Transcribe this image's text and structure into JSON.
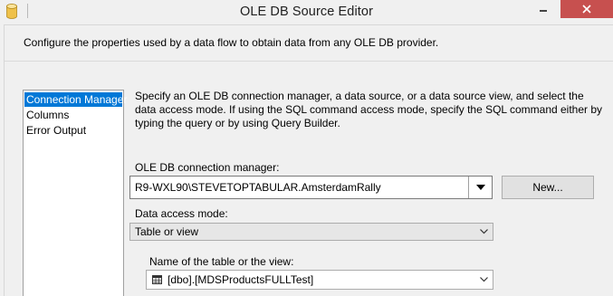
{
  "window": {
    "title": "OLE DB Source Editor",
    "icon": "database-icon",
    "close_color": "#c7504f"
  },
  "header": {
    "intro": "Configure the properties used by a data flow to obtain data from any OLE DB provider."
  },
  "nav": {
    "items": [
      {
        "label": "Connection Manager",
        "selected": true
      },
      {
        "label": "Columns",
        "selected": false
      },
      {
        "label": "Error Output",
        "selected": false
      }
    ],
    "selected_color": "#0078d7"
  },
  "main": {
    "description": "Specify an OLE DB connection manager, a data source, or a data source view, and select the data access mode. If using the SQL command access mode, specify the SQL command either by typing the query or by using Query Builder.",
    "connection_manager_label": "OLE DB connection manager:",
    "connection_manager_value": "R9-WXL90\\STEVETOPTABULAR.AmsterdamRally",
    "new_button": "New...",
    "data_access_mode_label": "Data access mode:",
    "data_access_mode_value": "Table or view",
    "table_label": "Name of the table or the view:",
    "table_value": "[dbo].[MDSProductsFULLTest]",
    "table_icon": "table-icon"
  }
}
